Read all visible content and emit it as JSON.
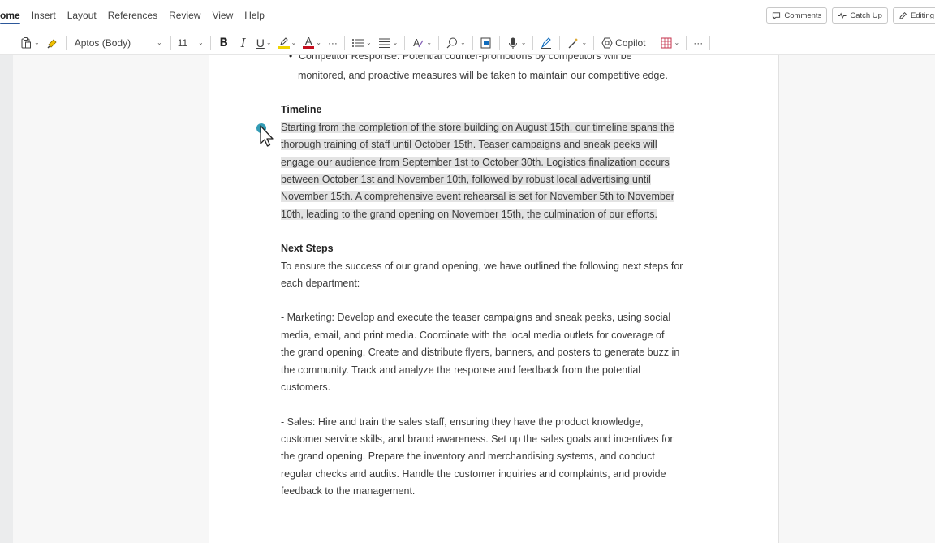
{
  "ribbon": {
    "tabs": [
      "ome",
      "Insert",
      "Layout",
      "References",
      "Review",
      "View",
      "Help"
    ],
    "active_tab": "ome",
    "right": {
      "comments": "Comments",
      "catch_up": "Catch Up",
      "editing": "Editing"
    }
  },
  "toolbar": {
    "font_name": "Aptos (Body)",
    "font_size": "11",
    "bold": "B",
    "italic": "I",
    "underline": "U",
    "more": "···",
    "copilot": "Copilot",
    "highlight_color": "#f0d400",
    "font_color": "#c50f1f"
  },
  "doc": {
    "prev_bullet_cut": "Competitor Response: Potential counter-promotions by competitors will be",
    "prev_bullet_line2": "monitored, and proactive measures will be taken to maintain our competitive edge.",
    "timeline_heading": "Timeline",
    "timeline_lines": [
      "Starting from the completion of the store building on August 15th, our timeline spans the",
      "thorough training of staff until October 15th. Teaser campaigns and sneak peeks will",
      "engage our audience from September 1st to October 30th. Logistics finalization occurs",
      "between October 1st and November 10th, followed by robust local advertising until",
      "November 15th. A comprehensive event rehearsal is set for November 5th to November",
      "10th, leading to the grand opening on November 15th, the culmination of our efforts."
    ],
    "next_heading": "Next Steps",
    "next_lines": [
      "To ensure the success of our grand opening, we have outlined the following next steps for",
      "each department:"
    ],
    "marketing_lines": [
      "- Marketing: Develop and execute the teaser campaigns and sneak peeks, using social",
      "media, email, and print media. Coordinate with the local media outlets for coverage of",
      "the grand opening. Create and distribute flyers, banners, and posters to generate buzz in",
      "the community. Track and analyze the response and feedback from the potential",
      "customers."
    ],
    "sales_lines": [
      "- Sales: Hire and train the sales staff, ensuring they have the product knowledge,",
      "customer service skills, and brand awareness. Set up the sales goals and incentives for",
      "the grand opening. Prepare the inventory and merchandising systems, and conduct",
      "regular checks and audits. Handle the customer inquiries and complaints, and provide",
      "feedback to the management."
    ]
  }
}
